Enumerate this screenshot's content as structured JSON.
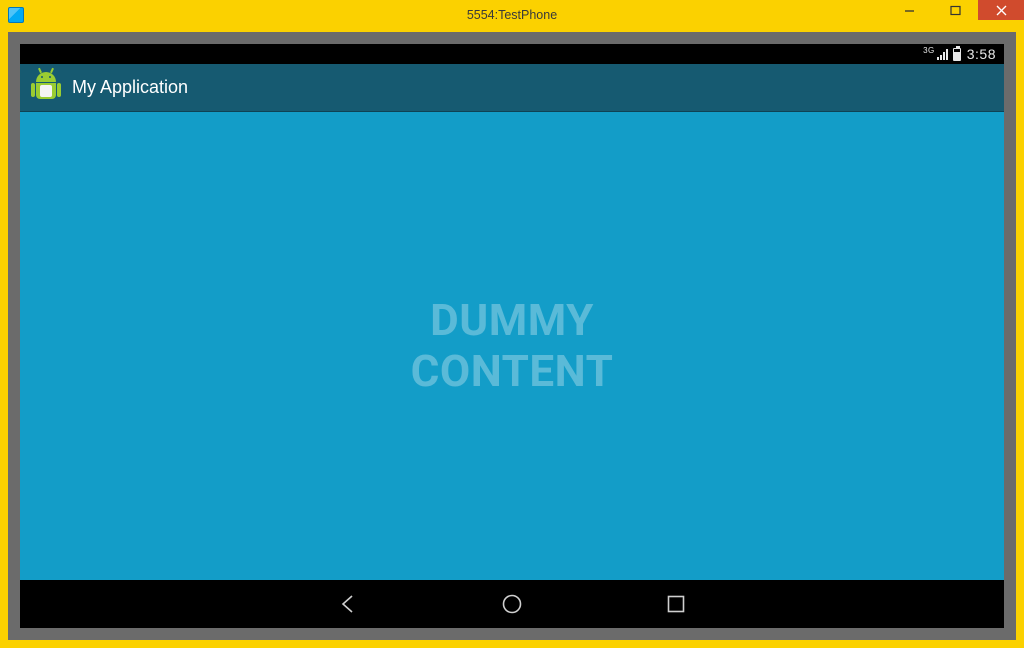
{
  "window": {
    "title": "5554:TestPhone"
  },
  "statusbar": {
    "network_label": "3G",
    "clock": "3:58"
  },
  "actionbar": {
    "title": "My Application"
  },
  "content": {
    "line1": "DUMMY",
    "line2": "CONTENT"
  }
}
